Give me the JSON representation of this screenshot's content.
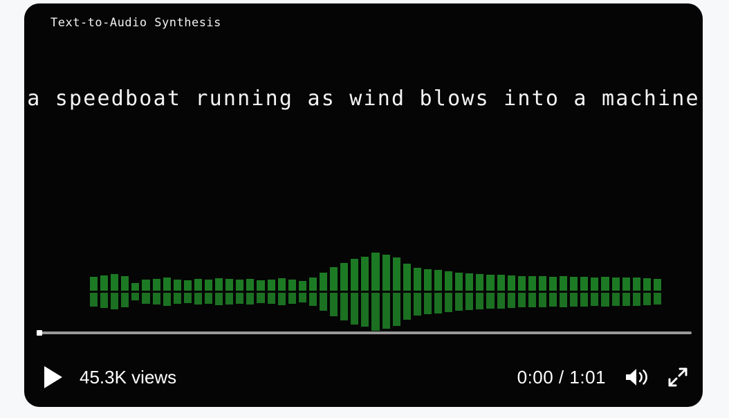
{
  "page": {
    "background_color": "#f7f8fa"
  },
  "player": {
    "panel_color": "#050505",
    "title": "Text-to-Audio Synthesis",
    "caption": "a speedboat running as wind blows into a machine",
    "waveform": {
      "bar_color": "#1d7a24",
      "bar_count": 55,
      "amplitudes": [
        0.38,
        0.41,
        0.45,
        0.4,
        0.22,
        0.3,
        0.33,
        0.35,
        0.31,
        0.29,
        0.33,
        0.31,
        0.34,
        0.32,
        0.3,
        0.33,
        0.28,
        0.31,
        0.34,
        0.3,
        0.26,
        0.36,
        0.49,
        0.62,
        0.74,
        0.84,
        0.9,
        1.0,
        0.95,
        0.88,
        0.72,
        0.6,
        0.57,
        0.55,
        0.52,
        0.49,
        0.47,
        0.45,
        0.43,
        0.42,
        0.41,
        0.4,
        0.39,
        0.4,
        0.38,
        0.39,
        0.37,
        0.38,
        0.36,
        0.37,
        0.36,
        0.35,
        0.36,
        0.34,
        0.33
      ]
    },
    "progress": {
      "percent": 0,
      "track_color": "#9a9a9a",
      "handle_color": "#ffffff"
    },
    "controls": {
      "play_label": "Play",
      "views_label": "45.3K views",
      "current_time": "0:00",
      "time_separator": "/",
      "total_time": "1:01",
      "time_display": "0:00 / 1:01",
      "volume_label": "Volume",
      "fullscreen_label": "Fullscreen",
      "icons": {
        "play": "play-icon",
        "volume": "volume-icon",
        "fullscreen": "fullscreen-icon"
      }
    }
  }
}
